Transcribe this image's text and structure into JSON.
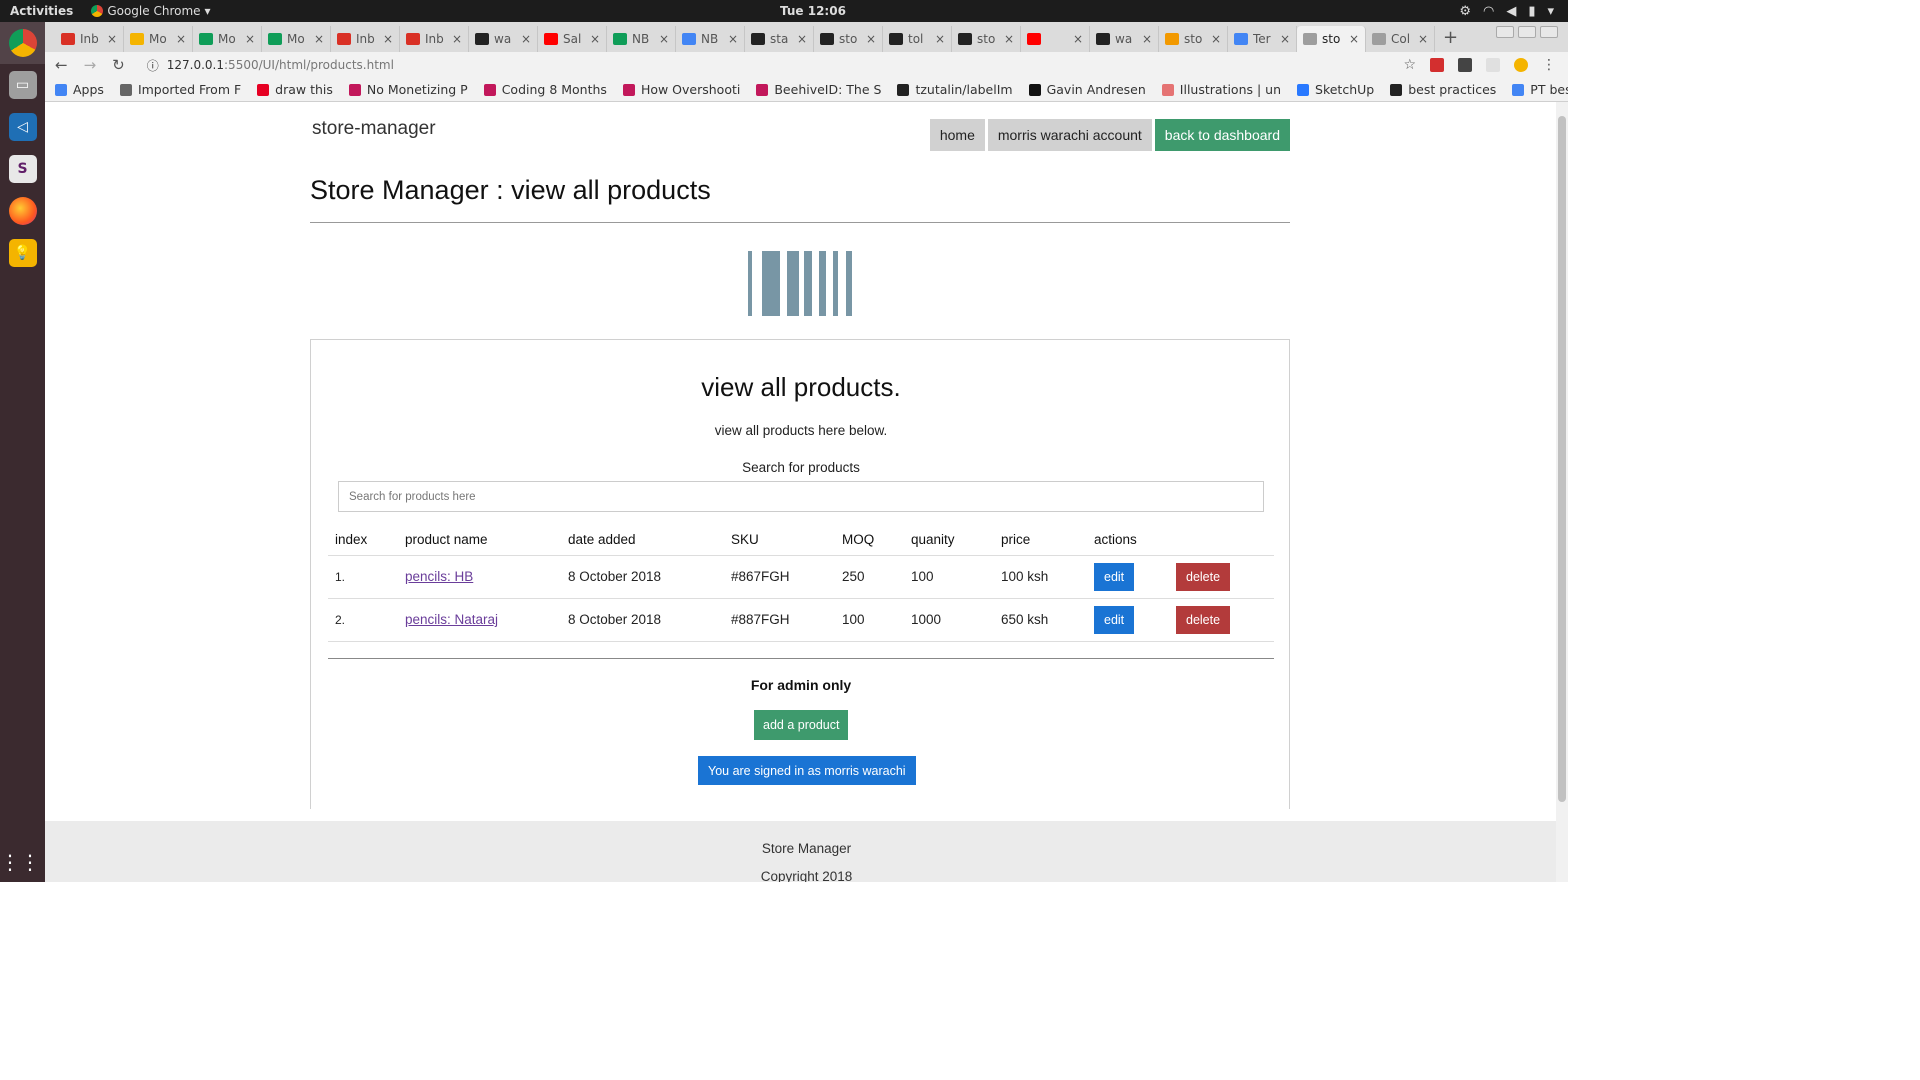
{
  "os": {
    "activities": "Activities",
    "app_name": "Google Chrome",
    "clock": "Tue 12:06"
  },
  "browser": {
    "tabs": [
      {
        "title": "Inb",
        "icon": "gmail-icon",
        "color": "#d93025"
      },
      {
        "title": "Mo",
        "icon": "drive-icon",
        "color": "#f4b400"
      },
      {
        "title": "Mo",
        "icon": "sheets-icon",
        "color": "#0f9d58"
      },
      {
        "title": "Mo",
        "icon": "sheets-icon",
        "color": "#0f9d58"
      },
      {
        "title": "Inb",
        "icon": "gmail-icon",
        "color": "#d93025"
      },
      {
        "title": "Inb",
        "icon": "gmail-icon",
        "color": "#d93025"
      },
      {
        "title": "wa",
        "icon": "github-icon",
        "color": "#222222"
      },
      {
        "title": "Sal",
        "icon": "youtube-icon",
        "color": "#ff0000"
      },
      {
        "title": "NB",
        "icon": "sheets-icon",
        "color": "#0f9d58"
      },
      {
        "title": "NB",
        "icon": "docs-icon",
        "color": "#4285f4"
      },
      {
        "title": "sta",
        "icon": "github-icon",
        "color": "#222222"
      },
      {
        "title": "sto",
        "icon": "github-icon",
        "color": "#222222"
      },
      {
        "title": "tol",
        "icon": "github-icon",
        "color": "#222222"
      },
      {
        "title": "sto",
        "icon": "github-icon",
        "color": "#222222"
      },
      {
        "title": "",
        "icon": "youtube-icon",
        "color": "#ff0000"
      },
      {
        "title": "wa",
        "icon": "github-icon",
        "color": "#222222"
      },
      {
        "title": "sto",
        "icon": "chrome-icon",
        "color": "#f29900"
      },
      {
        "title": "Ter",
        "icon": "docs-icon",
        "color": "#4285f4"
      },
      {
        "title": "sto",
        "icon": "page-icon",
        "color": "#9e9e9e",
        "active": true
      },
      {
        "title": "Col",
        "icon": "page-icon",
        "color": "#9e9e9e"
      }
    ],
    "url_host": "127.0.0.1",
    "url_path": ":5500/UI/html/products.html",
    "bookmarks": [
      {
        "label": "Apps",
        "icon": "apps-grid-icon",
        "color": "#4285f4"
      },
      {
        "label": "Imported From F",
        "icon": "folder-icon",
        "color": "#666666"
      },
      {
        "label": "draw this",
        "icon": "pinterest-icon",
        "color": "#e60023"
      },
      {
        "label": "No Monetizing P",
        "icon": "bookmark-red-icon",
        "color": "#c2185b"
      },
      {
        "label": "Coding 8 Months",
        "icon": "bookmark-red-icon",
        "color": "#c2185b"
      },
      {
        "label": "How Overshooti",
        "icon": "bookmark-red-icon",
        "color": "#c2185b"
      },
      {
        "label": "BeehiveID: The S",
        "icon": "bookmark-red-icon",
        "color": "#c2185b"
      },
      {
        "label": "tzutalin/labelIm",
        "icon": "github-icon",
        "color": "#222222"
      },
      {
        "label": "Gavin Andresen",
        "icon": "circle-icon",
        "color": "#111111"
      },
      {
        "label": "Illustrations | un",
        "icon": "illustrations-icon",
        "color": "#e57373"
      },
      {
        "label": "SketchUp",
        "icon": "sketchup-icon",
        "color": "#2979ff"
      },
      {
        "label": "best practices",
        "icon": "github-icon",
        "color": "#222222"
      },
      {
        "label": "PT best practices",
        "icon": "docs-icon",
        "color": "#4285f4"
      }
    ]
  },
  "page": {
    "brand": "store-manager",
    "nav": {
      "home": "home",
      "account": "morris warachi account",
      "dashboard": "back to dashboard"
    },
    "title": "Store Manager : view all products",
    "card": {
      "heading": "view all products.",
      "subheading": "view all products here below.",
      "search_label": "Search for products",
      "search_placeholder": "Search for products here"
    },
    "table": {
      "headers": [
        "index",
        "product name",
        "date added",
        "SKU",
        "MOQ",
        "quanity",
        "price",
        "actions"
      ],
      "rows": [
        {
          "index": "1.",
          "name": "pencils: HB",
          "date": "8 October 2018",
          "sku": "#867FGH",
          "moq": "250",
          "quantity": "100",
          "price": "100 ksh",
          "edit": "edit",
          "delete": "delete"
        },
        {
          "index": "2.",
          "name": "pencils: Nataraj",
          "date": "8 October 2018",
          "sku": "#887FGH",
          "moq": "100",
          "quantity": "1000",
          "price": "650 ksh",
          "edit": "edit",
          "delete": "delete"
        }
      ]
    },
    "admin": {
      "label": "For admin only",
      "add_button": "add a product",
      "signed_in": "You are signed in as morris warachi"
    },
    "footer": {
      "line1": "Store Manager",
      "line2": "Copyright 2018"
    }
  },
  "colors": {
    "green": "#3e9a6d",
    "blue": "#1a74d4",
    "red": "#b33b3b",
    "barcode": "#7896a5"
  }
}
